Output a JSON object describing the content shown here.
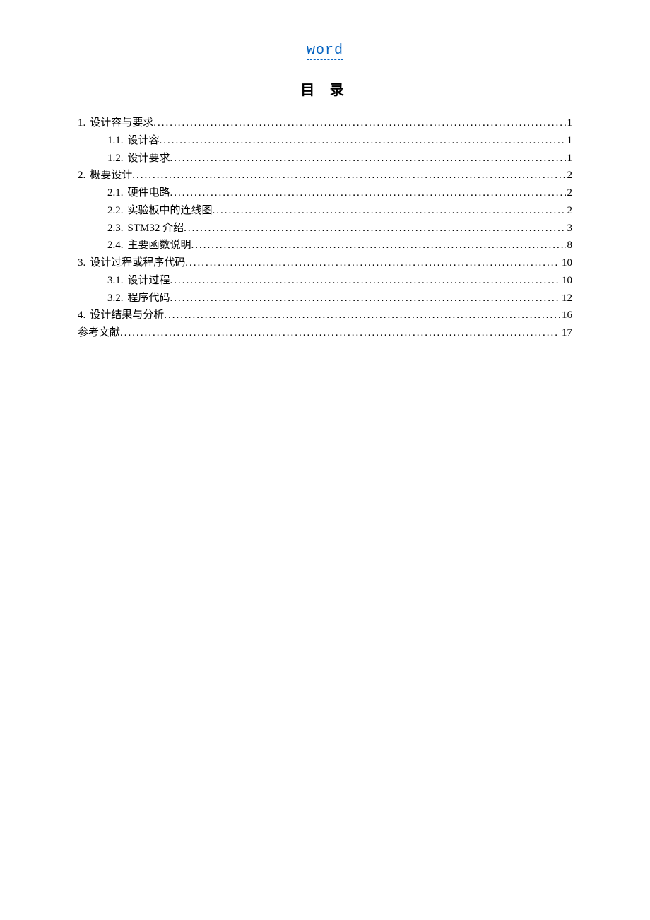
{
  "header": {
    "link_text": "word"
  },
  "title": "目 录",
  "toc": [
    {
      "level": 0,
      "num": "1.",
      "text": "设计容与要求",
      "page": "1"
    },
    {
      "level": 1,
      "num": "1.1.",
      "text": "设计容",
      "page": "1"
    },
    {
      "level": 1,
      "num": "1.2.",
      "text": "设计要求",
      "page": "1"
    },
    {
      "level": 0,
      "num": "2.",
      "text": "概要设计",
      "page": "2"
    },
    {
      "level": 1,
      "num": "2.1.",
      "text": "硬件电路",
      "page": "2"
    },
    {
      "level": 1,
      "num": "2.2.",
      "text": "实验板中的连线图",
      "page": "2"
    },
    {
      "level": 1,
      "num": "2.3.",
      "text": "STM32 介绍",
      "page": "3"
    },
    {
      "level": 1,
      "num": "2.4.",
      "text": "主要函数说明",
      "page": "8"
    },
    {
      "level": 0,
      "num": "3.",
      "text": "设计过程或程序代码",
      "page": "10"
    },
    {
      "level": 1,
      "num": "3.1.",
      "text": "设计过程",
      "page": "10"
    },
    {
      "level": 1,
      "num": "3.2.",
      "text": "程序代码",
      "page": "12"
    },
    {
      "level": 0,
      "num": "4.",
      "text": "设计结果与分析",
      "page": "16"
    },
    {
      "level": 0,
      "num": "",
      "text": "参考文献",
      "page": "17"
    }
  ]
}
